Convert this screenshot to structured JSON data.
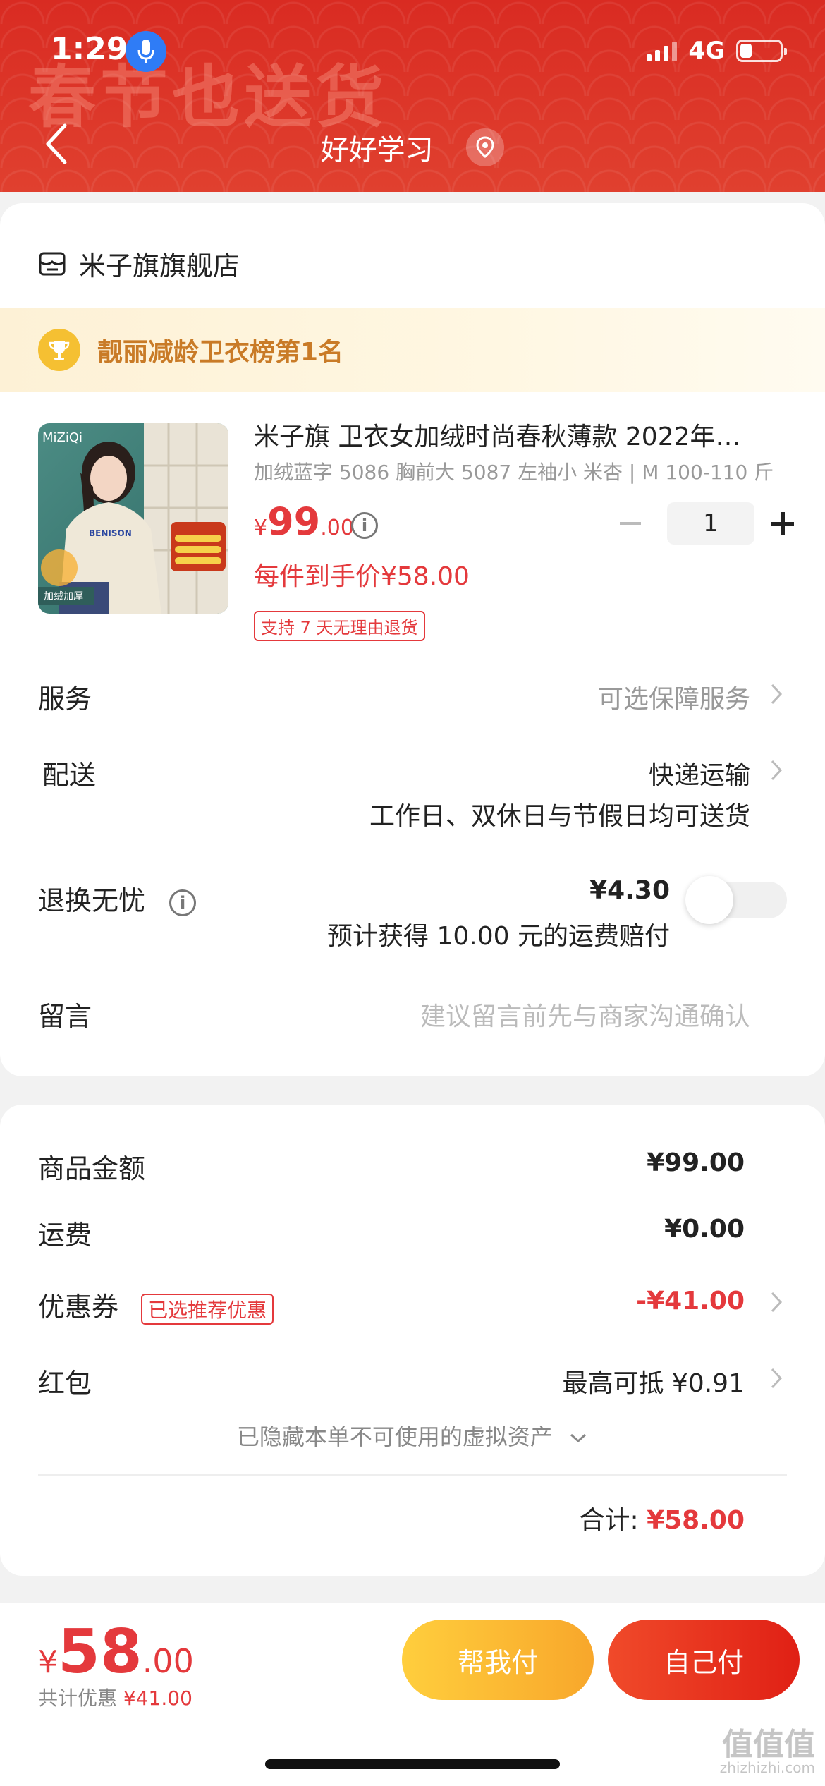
{
  "status": {
    "time": "1:29",
    "network": "4G"
  },
  "header": {
    "banner": "春节也送货",
    "title": "好好学习"
  },
  "shop": {
    "name": "米子旗旗舰店"
  },
  "rank": {
    "text": "靓丽减龄卫衣榜第1名"
  },
  "product": {
    "image_brand": "MiZiQi",
    "image_badge": "加绒加厚",
    "title": "米子旗 卫衣女加绒时尚春秋薄款 2022年…",
    "sku": "加绒蓝字 5086 胸前大 5087 左袖小 米杏 | M 100-110 斤",
    "price_currency": "¥",
    "price_int": "99",
    "price_dec": ".00",
    "unit_price": "每件到手价¥58.00",
    "return_policy": "支持 7 天无理由退货",
    "quantity": "1"
  },
  "rows": {
    "service_label": "服务",
    "service_value": "可选保障服务",
    "delivery_label": "配送",
    "delivery_value": "快递运输",
    "delivery_note": "工作日、双休日与节假日均可送货",
    "insurance_label": "退换无忧",
    "insurance_price": "¥4.30",
    "insurance_note": "预计获得 10.00 元的运费赔付",
    "message_label": "留言",
    "message_placeholder": "建议留言前先与商家沟通确认"
  },
  "summary": {
    "goods_label": "商品金额",
    "goods_value": "¥99.00",
    "shipping_label": "运费",
    "shipping_value": "¥0.00",
    "coupon_label": "优惠券",
    "coupon_tag": "已选推荐优惠",
    "coupon_value": "-¥41.00",
    "redpacket_label": "红包",
    "redpacket_value": "最高可抵 ¥0.91",
    "hidden_assets": "已隐藏本单不可使用的虚拟资产",
    "total_label": "合计:",
    "total_value": "¥58.00"
  },
  "bottom": {
    "total_currency": "¥",
    "total_int": "58",
    "total_dec": ".00",
    "saved_label": "共计优惠",
    "saved_value": "¥41.00",
    "friend_pay": "帮我付",
    "self_pay": "自己付"
  },
  "watermark": {
    "main": "值值值",
    "sub": "zhizhizhi.com"
  },
  "colors": {
    "accent": "#e4393c",
    "header": "#d92b22",
    "gold": "#f5c032"
  }
}
